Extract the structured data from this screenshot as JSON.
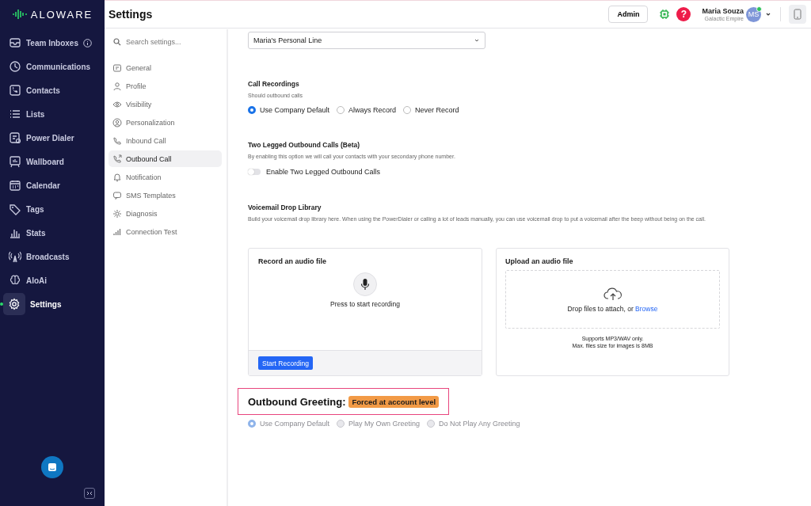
{
  "brand": {
    "name": "ALOWARE"
  },
  "sidebar": {
    "items": [
      {
        "label": "Team Inboxes",
        "selected": false,
        "info": true
      },
      {
        "label": "Communications",
        "selected": false
      },
      {
        "label": "Contacts",
        "selected": false
      },
      {
        "label": "Lists",
        "selected": false
      },
      {
        "label": "Power Dialer",
        "selected": false
      },
      {
        "label": "Wallboard",
        "selected": false
      },
      {
        "label": "Calendar",
        "selected": false
      },
      {
        "label": "Tags",
        "selected": false
      },
      {
        "label": "Stats",
        "selected": false
      },
      {
        "label": "Broadcasts",
        "selected": false
      },
      {
        "label": "AloAi",
        "selected": false
      },
      {
        "label": "Settings",
        "selected": true
      }
    ]
  },
  "header": {
    "title": "Settings",
    "role_button": "Admin",
    "help": "?",
    "user": {
      "name": "Maria Souza",
      "company": "Galactic Empire",
      "initials": "MS",
      "online": true
    }
  },
  "settings_nav": {
    "search": {
      "placeholder": "Search settings..."
    },
    "items": [
      {
        "label": "General",
        "selected": false
      },
      {
        "label": "Profile",
        "selected": false
      },
      {
        "label": "Visibility",
        "selected": false
      },
      {
        "label": "Personalization",
        "selected": false
      },
      {
        "label": "Inbound Call",
        "selected": false
      },
      {
        "label": "Outbound Call",
        "selected": true
      },
      {
        "label": "Notification",
        "selected": false
      },
      {
        "label": "SMS Templates",
        "selected": false
      },
      {
        "label": "Diagnosis",
        "selected": false
      },
      {
        "label": "Connection Test",
        "selected": false
      }
    ]
  },
  "line_select": {
    "value": "Maria's Personal Line"
  },
  "call_recordings": {
    "title": "Call Recordings",
    "subtitle": "Should outbound calls",
    "options": [
      {
        "label": "Use Company Default",
        "selected": true,
        "disabled": false
      },
      {
        "label": "Always Record",
        "selected": false,
        "disabled": false
      },
      {
        "label": "Never Record",
        "selected": false,
        "disabled": false
      }
    ]
  },
  "two_legged": {
    "title": "Two Legged Outbound Calls (Beta)",
    "description": "By enabling this option we will call your contacts with your secondary phone number.",
    "toggle": {
      "label": "Enable Two Legged Outbound Calls",
      "on": false
    }
  },
  "voicemail": {
    "title": "Voicemail Drop Library",
    "description": "Build your voicemail drop library here. When using the PowerDialer or calling a lot of leads manually, you can use voicemail drop to put a voicemail after the beep without being on the call.",
    "record_card": {
      "title": "Record an audio file",
      "hint": "Press to start recording",
      "button": "Start Recording"
    },
    "upload_card": {
      "title": "Upload an audio file",
      "drop_text": "Drop files to attach, or",
      "browse": "Browse",
      "notes": [
        "Supports MP3/WAV only.",
        "Max. files size for images is 8MB"
      ]
    }
  },
  "outbound_greeting": {
    "title": "Outbound Greeting:",
    "badge": "Forced at account level",
    "options": [
      {
        "label": "Use Company Default",
        "selected": true,
        "disabled": true
      },
      {
        "label": "Play My Own Greeting",
        "selected": false,
        "disabled": true
      },
      {
        "label": "Do Not Play Any Greeting",
        "selected": false,
        "disabled": true
      }
    ]
  }
}
